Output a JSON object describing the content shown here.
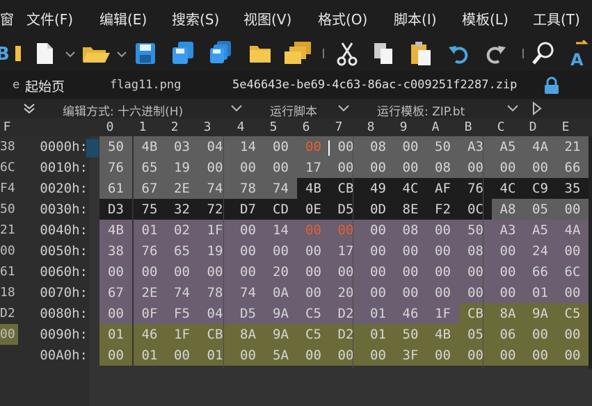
{
  "menu": [
    "窗",
    "文件(F)",
    "编辑(E)",
    "搜索(S)",
    "视图(V)",
    "格式(O)",
    "脚本(I)",
    "模板(L)",
    "工具(T)"
  ],
  "toolbar_icons": [
    "b-partial-icon",
    "new-file-icon",
    "open-folder-icon",
    "save-icon",
    "save-as-icon",
    "save-all-icon",
    "folder-icon",
    "folders-icon",
    "cut-icon",
    "copy-icon",
    "paste-icon",
    "undo-icon",
    "redo-icon",
    "find-icon",
    "replace-icon"
  ],
  "tabs": {
    "partial": "e",
    "start": "起始页",
    "file1": "flag11.png",
    "file2": "5e46643e-be69-4c63-86ac-c009251f2287.zip"
  },
  "options": {
    "edit_as": "编辑方式: 十六进制(H)",
    "run_script": "运行脚本",
    "run_template": "运行模板: ZIP.bt"
  },
  "left_header": "F",
  "columns": [
    "0",
    "1",
    "2",
    "3",
    "4",
    "5",
    "6",
    "7",
    "8",
    "9",
    "A",
    "B",
    "C",
    "D",
    "E"
  ],
  "left_strip": [
    "38",
    "6C",
    "F4",
    "50",
    "21",
    "00",
    "61",
    "18",
    "D2",
    "00",
    ""
  ],
  "rows": [
    {
      "offset": "0000h:",
      "bytes": [
        "50",
        "4B",
        "03",
        "04",
        "14",
        "00",
        "00",
        "00",
        "08",
        "00",
        "50",
        "A3",
        "A5",
        "4A",
        "21"
      ]
    },
    {
      "offset": "0010h:",
      "bytes": [
        "76",
        "65",
        "19",
        "00",
        "00",
        "00",
        "17",
        "00",
        "00",
        "00",
        "08",
        "00",
        "00",
        "00",
        "66"
      ]
    },
    {
      "offset": "0020h:",
      "bytes": [
        "61",
        "67",
        "2E",
        "74",
        "78",
        "74",
        "4B",
        "CB",
        "49",
        "4C",
        "AF",
        "76",
        "4C",
        "C9",
        "35"
      ]
    },
    {
      "offset": "0030h:",
      "bytes": [
        "D3",
        "75",
        "32",
        "72",
        "D7",
        "CD",
        "0E",
        "D5",
        "0D",
        "8E",
        "F2",
        "0C",
        "A8",
        "05",
        "00"
      ]
    },
    {
      "offset": "0040h:",
      "bytes": [
        "4B",
        "01",
        "02",
        "1F",
        "00",
        "14",
        "00",
        "00",
        "00",
        "08",
        "00",
        "50",
        "A3",
        "A5",
        "4A"
      ]
    },
    {
      "offset": "0050h:",
      "bytes": [
        "38",
        "76",
        "65",
        "19",
        "00",
        "00",
        "00",
        "17",
        "00",
        "00",
        "00",
        "08",
        "00",
        "24",
        "00"
      ]
    },
    {
      "offset": "0060h:",
      "bytes": [
        "00",
        "00",
        "00",
        "00",
        "00",
        "20",
        "00",
        "00",
        "00",
        "00",
        "00",
        "00",
        "00",
        "66",
        "6C"
      ]
    },
    {
      "offset": "0070h:",
      "bytes": [
        "67",
        "2E",
        "74",
        "78",
        "74",
        "0A",
        "00",
        "20",
        "00",
        "00",
        "00",
        "00",
        "00",
        "01",
        "00"
      ]
    },
    {
      "offset": "0080h:",
      "bytes": [
        "00",
        "0F",
        "F5",
        "04",
        "D5",
        "9A",
        "C5",
        "D2",
        "01",
        "46",
        "1F",
        "CB",
        "8A",
        "9A",
        "C5"
      ]
    },
    {
      "offset": "0090h:",
      "bytes": [
        "01",
        "46",
        "1F",
        "CB",
        "8A",
        "9A",
        "C5",
        "D2",
        "01",
        "50",
        "4B",
        "05",
        "06",
        "00",
        "00"
      ]
    },
    {
      "offset": "00A0h:",
      "bytes": [
        "00",
        "01",
        "00",
        "01",
        "00",
        "5A",
        "00",
        "00",
        "00",
        "3F",
        "00",
        "00",
        "00",
        "00",
        "00"
      ]
    }
  ],
  "colors": {
    "region_header": "#5e5e5e",
    "region_data": "#1d1d1d",
    "region_central": "#6a5e70",
    "region_end": "#6b6b3a",
    "highlight_text": "#e0622c",
    "cursor_block": "#1e4a6a"
  }
}
